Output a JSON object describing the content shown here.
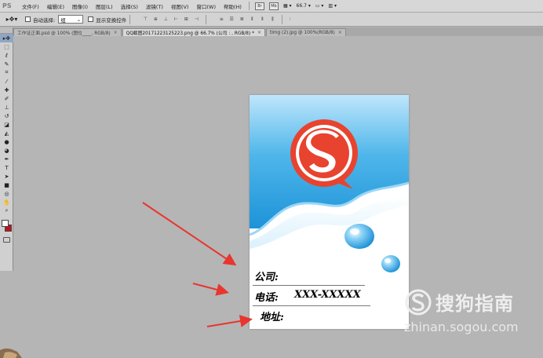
{
  "app": {
    "logo": "PS"
  },
  "menu": [
    {
      "label": "文件(F)"
    },
    {
      "label": "编辑(E)"
    },
    {
      "label": "图像(I)"
    },
    {
      "label": "图层(L)"
    },
    {
      "label": "选择(S)"
    },
    {
      "label": "滤镜(T)"
    },
    {
      "label": "视图(V)"
    },
    {
      "label": "窗口(W)"
    },
    {
      "label": "帮助(H)"
    }
  ],
  "menubar_extra": {
    "br_icon": "Br",
    "mb_icon": "Mb",
    "zoom": "66.7"
  },
  "options": {
    "auto_select_label": "自动选择:",
    "auto_select_value": "组",
    "show_transform_label": "显示变换控件"
  },
  "tabs": [
    {
      "label": "工作证正面.psd @ 100% (图位____, RGB/8)",
      "active": false
    },
    {
      "label": "QQ截图20171223125223.png @ 66.7% (公司 : , RGB/8) *",
      "active": true
    },
    {
      "label": "timg (2).jpg @ 100%(RGB/8)",
      "active": false
    }
  ],
  "card": {
    "company_label": "公司:",
    "phone_label": "电话:",
    "phone_value": "XXX-XXXXX",
    "address_label": "地址:"
  },
  "watermark": {
    "title": "搜狗指南",
    "url": "zhinan.sogou.com"
  },
  "colors": {
    "foreground": "#ffffff",
    "background": "#c1121b",
    "arrow": "#e8352e",
    "logo_red": "#e8432f",
    "card_blue": "#2a9fde"
  }
}
